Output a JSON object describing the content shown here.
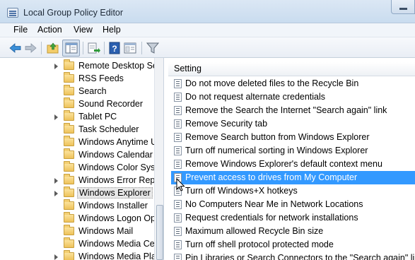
{
  "window": {
    "title": "Local Group Policy Editor"
  },
  "menu": [
    "File",
    "Action",
    "View",
    "Help"
  ],
  "toolbar_icons": [
    "back-arrow-icon",
    "forward-arrow-icon",
    "up-folder-icon",
    "show-hide-tree-icon",
    "export-list-icon",
    "help-icon",
    "properties-icon",
    "filter-icon"
  ],
  "tree": {
    "items": [
      {
        "label": "Remote Desktop Ser",
        "expandable": true
      },
      {
        "label": "RSS Feeds",
        "expandable": false
      },
      {
        "label": "Search",
        "expandable": false
      },
      {
        "label": "Sound Recorder",
        "expandable": false
      },
      {
        "label": "Tablet PC",
        "expandable": true
      },
      {
        "label": "Task Scheduler",
        "expandable": false
      },
      {
        "label": "Windows Anytime U",
        "expandable": false
      },
      {
        "label": "Windows Calendar",
        "expandable": false
      },
      {
        "label": "Windows Color Syst",
        "expandable": false
      },
      {
        "label": "Windows Error Repo",
        "expandable": true
      },
      {
        "label": "Windows Explorer",
        "expandable": true
      },
      {
        "label": "Windows Installer",
        "expandable": false
      },
      {
        "label": "Windows Logon Op",
        "expandable": false
      },
      {
        "label": "Windows Mail",
        "expandable": false
      },
      {
        "label": "Windows Media Cer",
        "expandable": false
      },
      {
        "label": "Windows Media Pla",
        "expandable": true
      }
    ],
    "selected": "Windows Explorer"
  },
  "list": {
    "column_header": "Setting",
    "rows": [
      "Do not move deleted files to the Recycle Bin",
      "Do not request alternate credentials",
      "Remove the Search the Internet \"Search again\" link",
      "Remove Security tab",
      "Remove Search button from Windows Explorer",
      "Turn off numerical sorting in Windows Explorer",
      "Remove Windows Explorer's default context menu",
      "Prevent access to drives from My Computer",
      "Turn off Windows+X hotkeys",
      "No Computers Near Me in Network Locations",
      "Request credentials for network installations",
      "Maximum allowed Recycle Bin size",
      "Turn off shell protocol protected mode",
      "Pin Libraries or Search Connectors to the \"Search again\" link"
    ],
    "selected": "Prevent access to drives from My Computer"
  },
  "colors": {
    "selection": "#3399ff",
    "titlebar": "#c9dcef"
  }
}
